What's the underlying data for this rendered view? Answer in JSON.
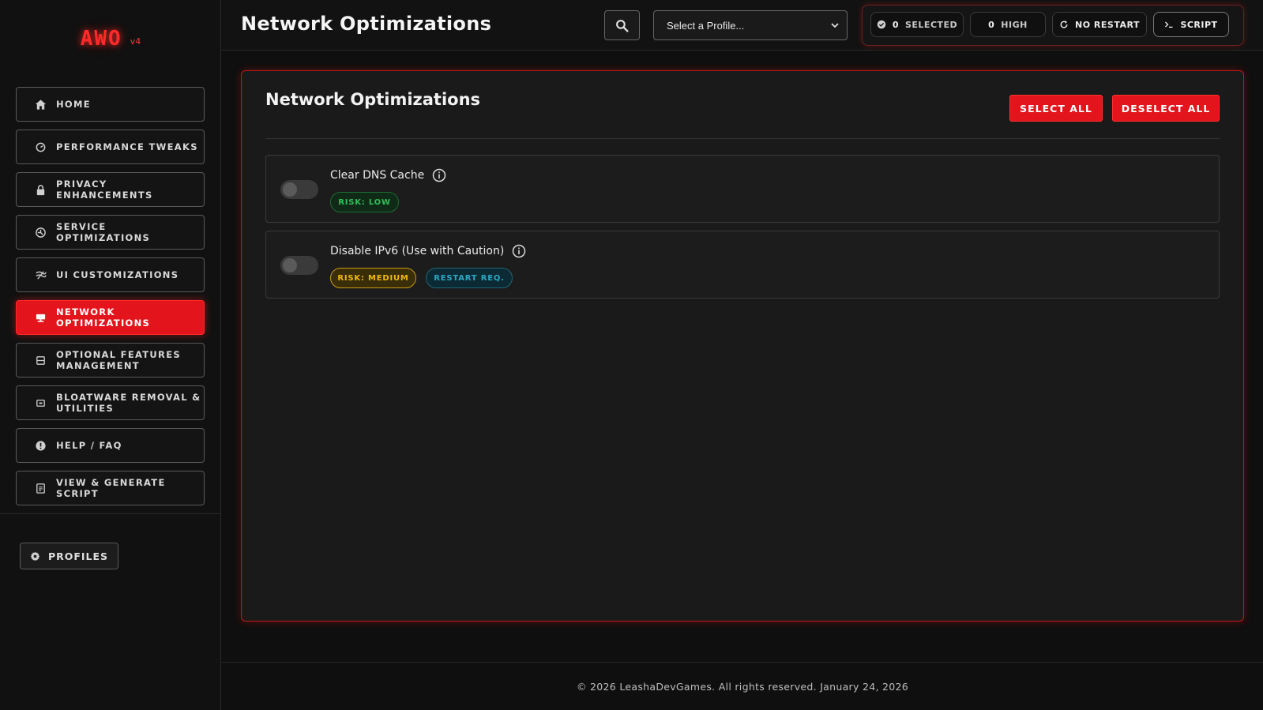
{
  "app": {
    "logo": "AWO",
    "version": "v4"
  },
  "sidebar": {
    "items": [
      {
        "label": "HOME",
        "icon": "home-icon",
        "active": false
      },
      {
        "label": "PERFORMANCE TWEAKS",
        "icon": "speed-icon",
        "active": false
      },
      {
        "label": "PRIVACY ENHANCEMENTS",
        "icon": "lock-icon",
        "active": false
      },
      {
        "label": "SERVICE OPTIMIZATIONS",
        "icon": "service-icon",
        "active": false
      },
      {
        "label": "UI CUSTOMIZATIONS",
        "icon": "ui-icon",
        "active": false
      },
      {
        "label": "NETWORK OPTIMIZATIONS",
        "icon": "network-icon",
        "active": true
      },
      {
        "label": "OPTIONAL FEATURES MANAGEMENT",
        "icon": "features-icon",
        "active": false
      },
      {
        "label": "BLOATWARE REMOVAL & UTILITIES",
        "icon": "bloatware-icon",
        "active": false
      },
      {
        "label": "HELP / FAQ",
        "icon": "help-icon",
        "active": false
      },
      {
        "label": "VIEW & GENERATE SCRIPT",
        "icon": "script-doc-icon",
        "active": false
      }
    ],
    "profiles_label": "PROFILES"
  },
  "header": {
    "title": "Network Optimizations",
    "profile_select": {
      "value": "Select a Profile..."
    },
    "status": {
      "selected_count": "0",
      "selected_label": "SELECTED",
      "high_count": "0",
      "high_label": "HIGH",
      "restart_label": "NO RESTART",
      "script_label": "SCRIPT"
    }
  },
  "main": {
    "title": "Network Optimizations",
    "select_all_label": "SELECT ALL",
    "deselect_all_label": "DESELECT ALL",
    "tweaks": [
      {
        "name": "Clear DNS Cache",
        "enabled": false,
        "badges": [
          "RISK: LOW"
        ]
      },
      {
        "name": "Disable IPv6 (Use with Caution)",
        "enabled": false,
        "badges": [
          "RISK: MEDIUM",
          "RESTART REQ."
        ]
      }
    ]
  },
  "footer": {
    "text": "© 2026 LeashaDevGames. All rights reserved. January 24, 2026"
  },
  "colors": {
    "accent": "#e3141b",
    "risk_low": "#2fbf57",
    "risk_medium": "#f0b90b",
    "restart": "#2aa8c4"
  }
}
